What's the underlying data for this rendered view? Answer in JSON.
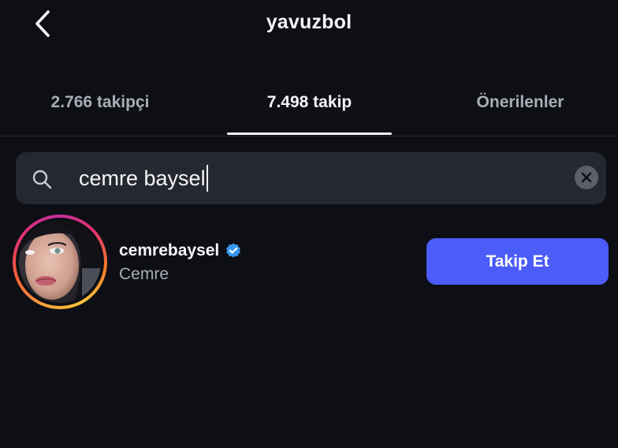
{
  "header": {
    "title": "yavuzbol",
    "back_icon": "chevron-left-icon"
  },
  "tabs": [
    {
      "label": "2.766 takipçi",
      "active": false
    },
    {
      "label": "7.498 takip",
      "active": true
    },
    {
      "label": "Önerilenler",
      "active": false
    }
  ],
  "search": {
    "value": "cemre baysel",
    "search_icon": "search-icon",
    "clear_icon": "clear-icon"
  },
  "results": [
    {
      "username": "cemrebaysel",
      "verified": true,
      "full_name": "Cemre",
      "button_label": "Takip Et"
    }
  ],
  "colors": {
    "background": "#0d0f14",
    "search_bg": "#252830",
    "accent_button": "#4b5cf8",
    "verified_blue": "#3897f0",
    "muted_text": "#a9adb6"
  }
}
